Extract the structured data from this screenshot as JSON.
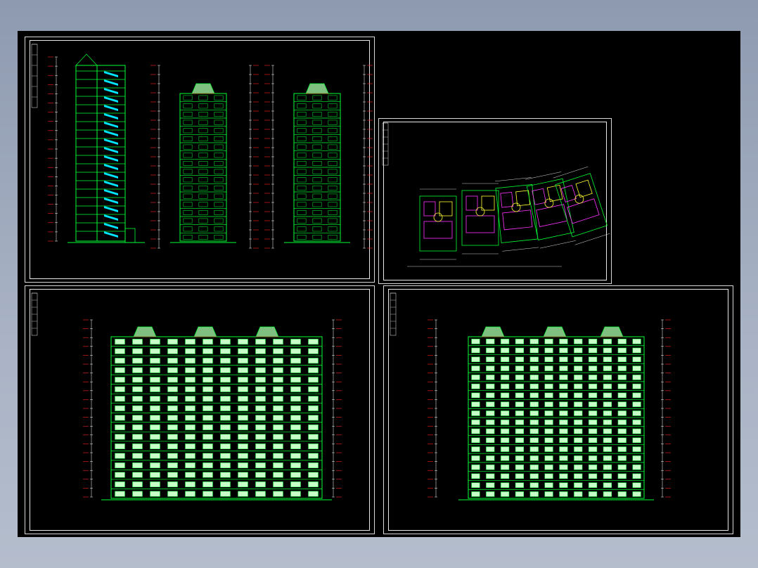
{
  "app": {
    "background": "#000000",
    "page_background": "#9aa5b8"
  },
  "colors": {
    "frame": "#e6e6e6",
    "building_line": "#00ff33",
    "accent_red": "#ff2020",
    "fill_light": "#c8ffc8",
    "stair_cyan": "#00e5ff",
    "plan_magenta": "#ff33ff",
    "plan_yellow": "#ffff33",
    "dimension_white": "#ffffff"
  },
  "sheets": [
    {
      "id": "sections-sheet",
      "content": "section-and-side-elevations"
    },
    {
      "id": "floor-plan-sheet",
      "content": "standard-floor-plan"
    },
    {
      "id": "front-elevation-sheet",
      "content": "front-elevation"
    },
    {
      "id": "rear-elevation-sheet",
      "content": "rear-elevation"
    }
  ]
}
